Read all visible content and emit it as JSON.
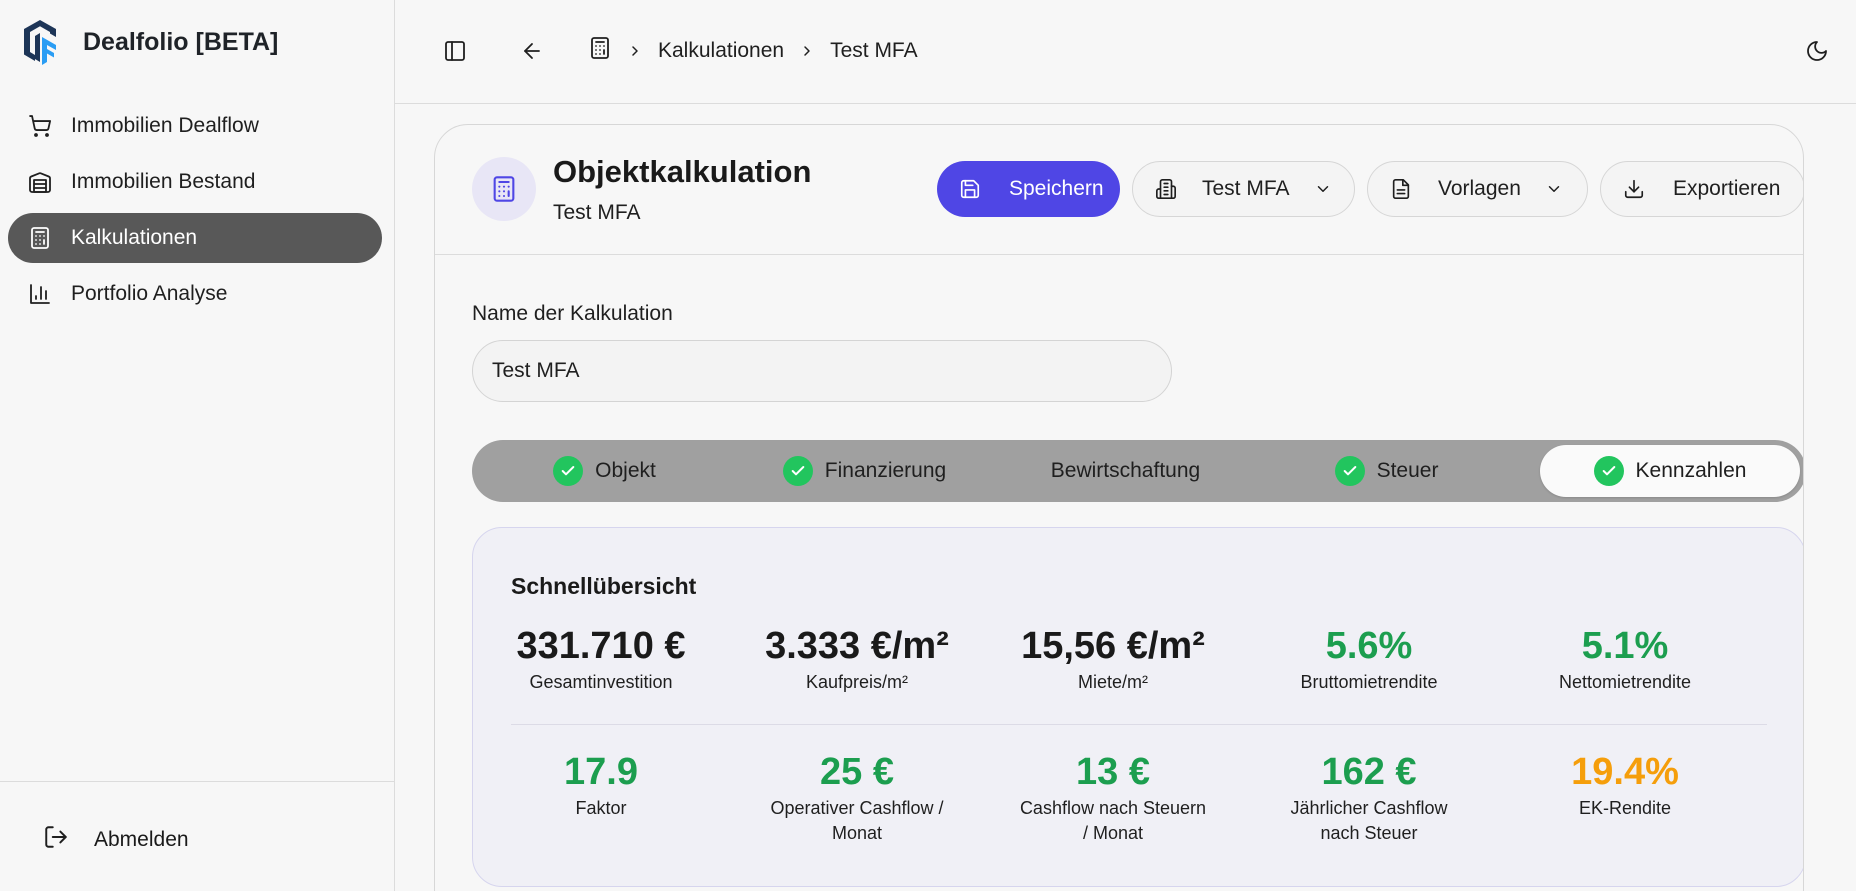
{
  "app": {
    "name": "Dealfolio [BETA]"
  },
  "sidebar": {
    "items": [
      {
        "label": "Immobilien Dealflow",
        "icon": "cart-icon"
      },
      {
        "label": "Immobilien Bestand",
        "icon": "warehouse-icon"
      },
      {
        "label": "Kalkulationen",
        "icon": "calculator-icon",
        "active": true
      },
      {
        "label": "Portfolio Analyse",
        "icon": "bar-chart-icon"
      }
    ],
    "logout_label": "Abmelden"
  },
  "topbar": {
    "breadcrumb": [
      "Kalkulationen",
      "Test MFA"
    ]
  },
  "header": {
    "title": "Objektkalkulation",
    "subtitle": "Test MFA",
    "save_label": "Speichern",
    "property_select": "Test MFA",
    "templates_label": "Vorlagen",
    "export_label": "Exportieren"
  },
  "form": {
    "name_label": "Name der Kalkulation",
    "name_value": "Test MFA"
  },
  "tabs": [
    {
      "label": "Objekt",
      "done": true
    },
    {
      "label": "Finanzierung",
      "done": true
    },
    {
      "label": "Bewirtschaftung",
      "done": false
    },
    {
      "label": "Steuer",
      "done": true
    },
    {
      "label": "Kennzahlen",
      "done": true,
      "active": true
    }
  ],
  "overview": {
    "title": "Schnellübersicht",
    "row1": [
      {
        "value": "331.710 €",
        "label": "Gesamtinvestition",
        "color": "#1a1a1a"
      },
      {
        "value": "3.333 €/m²",
        "label": "Kaufpreis/m²",
        "color": "#1a1a1a"
      },
      {
        "value": "15,56 €/m²",
        "label": "Miete/m²",
        "color": "#1a1a1a"
      },
      {
        "value": "5.6%",
        "label": "Bruttomietrendite",
        "color": "#1c9e4f"
      },
      {
        "value": "5.1%",
        "label": "Nettomietrendite",
        "color": "#1c9e4f"
      }
    ],
    "row2": [
      {
        "value": "17.9",
        "label": "Faktor",
        "color": "#1c9e4f"
      },
      {
        "value": "25 €",
        "label": "Operativer Cashflow / Monat",
        "color": "#1c9e4f"
      },
      {
        "value": "13 €",
        "label": "Cashflow nach Steuern / Monat",
        "color": "#1c9e4f"
      },
      {
        "value": "162 €",
        "label": "Jährlicher Cashflow nach Steuer",
        "color": "#1c9e4f"
      },
      {
        "value": "19.4%",
        "label": "EK-Rendite",
        "color": "#f59e0b"
      }
    ]
  },
  "colors": {
    "primary": "#4f46e5",
    "success": "#22c55e",
    "warning": "#f59e0b"
  }
}
